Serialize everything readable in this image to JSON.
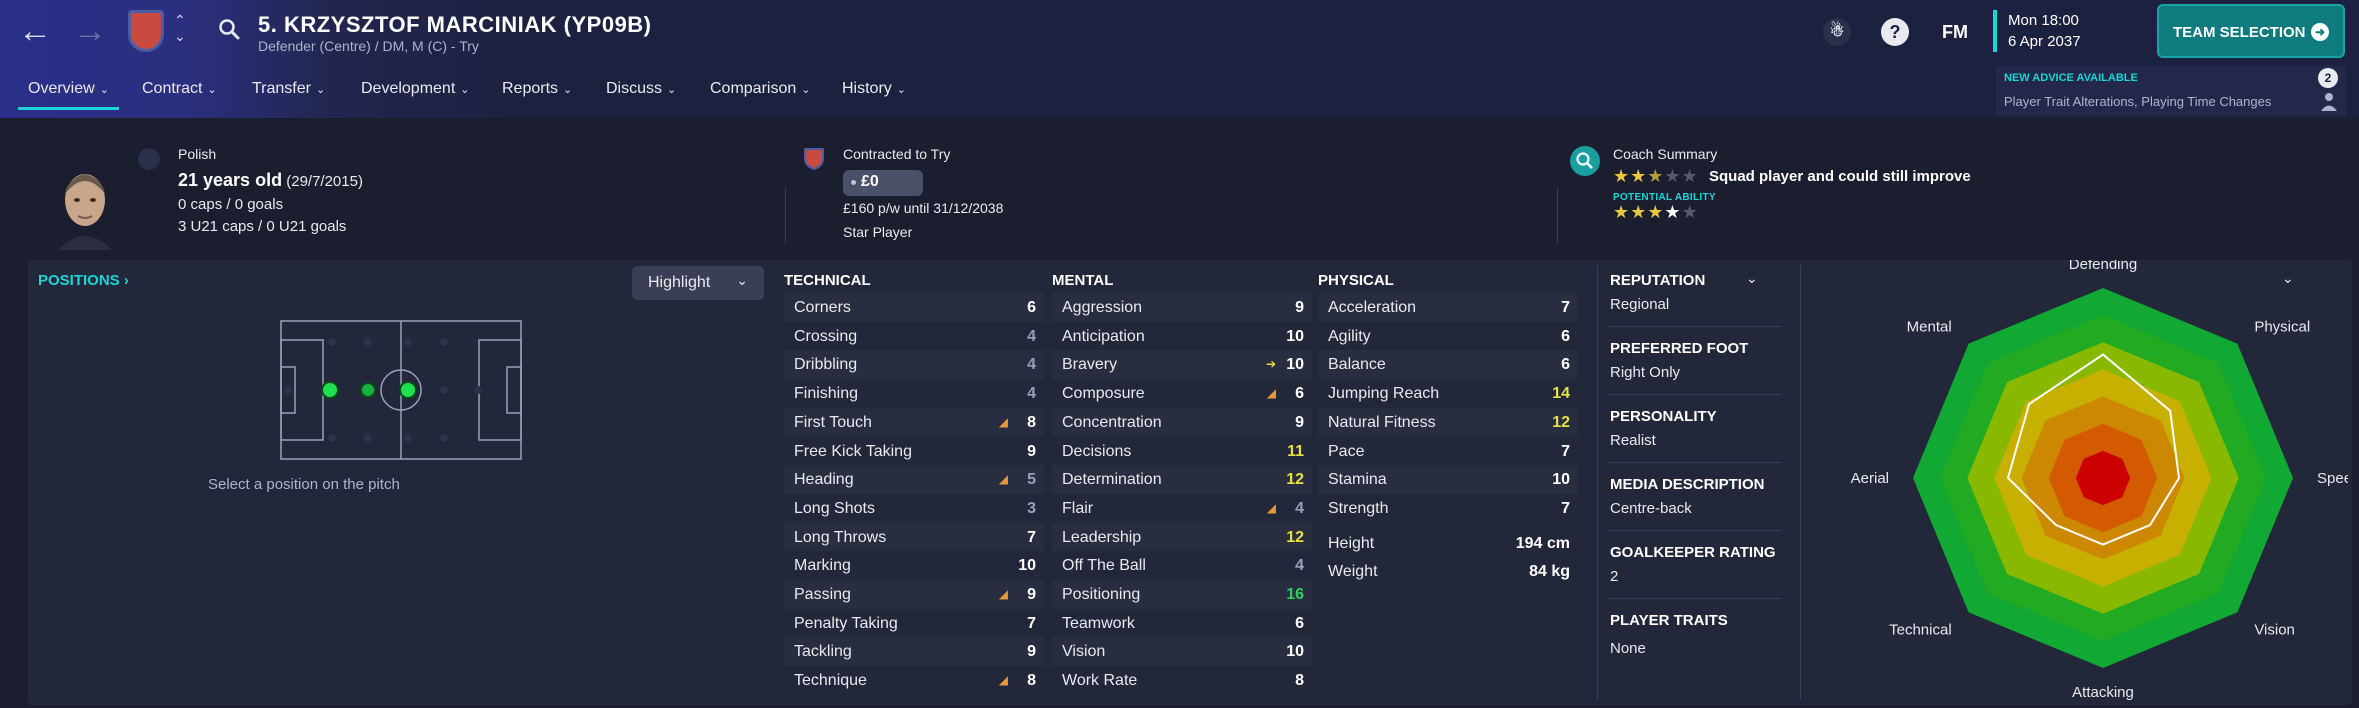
{
  "header": {
    "title": "5. KRZYSZTOF MARCINIAK (YP09B)",
    "subtitle": "Defender (Centre) / DM, M (C) - Try",
    "fm_logo": "FM",
    "time": "Mon 18:00",
    "date": "6 Apr 2037",
    "team_selection_label": "TEAM SELECTION",
    "help_icon": "?",
    "advice": {
      "title": "NEW ADVICE AVAILABLE",
      "text": "Player Trait Alterations, Playing Time Changes",
      "count": "2"
    },
    "tabs": [
      {
        "label": "Overview"
      },
      {
        "label": "Contract"
      },
      {
        "label": "Transfer"
      },
      {
        "label": "Development"
      },
      {
        "label": "Reports"
      },
      {
        "label": "Discuss"
      },
      {
        "label": "Comparison"
      },
      {
        "label": "History"
      }
    ]
  },
  "summary": {
    "nationality": "Polish",
    "age": "21 years old",
    "dob": "(29/7/2015)",
    "caps": "0 caps / 0 goals",
    "u21_caps": "3 U21 caps / 0 U21 goals",
    "contract_status": "Contracted to Try",
    "value": "£0",
    "wage": "£160 p/w until 31/12/2038",
    "status": "Star Player",
    "coach_title": "Coach Summary",
    "coach_comment": "Squad player and could still improve",
    "current_ability_stars": 2.5,
    "potential_label": "POTENTIAL ABILITY",
    "potential_ability_stars": 3.5
  },
  "positions": {
    "label": "POSITIONS",
    "highlight_label": "Highlight",
    "caption": "Select a position on the pitch"
  },
  "attributes": {
    "technical_label": "TECHNICAL",
    "mental_label": "MENTAL",
    "physical_label": "PHYSICAL",
    "technical": [
      {
        "name": "Corners",
        "value": "6",
        "tier": "mid"
      },
      {
        "name": "Crossing",
        "value": "4",
        "tier": "low"
      },
      {
        "name": "Dribbling",
        "value": "4",
        "tier": "low"
      },
      {
        "name": "Finishing",
        "value": "4",
        "tier": "low"
      },
      {
        "name": "First Touch",
        "value": "8",
        "tier": "mid",
        "trend": "up"
      },
      {
        "name": "Free Kick Taking",
        "value": "9",
        "tier": "mid"
      },
      {
        "name": "Heading",
        "value": "5",
        "tier": "low",
        "trend": "up"
      },
      {
        "name": "Long Shots",
        "value": "3",
        "tier": "low"
      },
      {
        "name": "Long Throws",
        "value": "7",
        "tier": "mid"
      },
      {
        "name": "Marking",
        "value": "10",
        "tier": "mid"
      },
      {
        "name": "Passing",
        "value": "9",
        "tier": "mid",
        "trend": "up"
      },
      {
        "name": "Penalty Taking",
        "value": "7",
        "tier": "mid"
      },
      {
        "name": "Tackling",
        "value": "9",
        "tier": "mid"
      },
      {
        "name": "Technique",
        "value": "8",
        "tier": "mid",
        "trend": "up"
      }
    ],
    "mental": [
      {
        "name": "Aggression",
        "value": "9",
        "tier": "mid"
      },
      {
        "name": "Anticipation",
        "value": "10",
        "tier": "mid"
      },
      {
        "name": "Bravery",
        "value": "10",
        "tier": "mid",
        "trend": "up2"
      },
      {
        "name": "Composure",
        "value": "6",
        "tier": "mid",
        "trend": "up"
      },
      {
        "name": "Concentration",
        "value": "9",
        "tier": "mid"
      },
      {
        "name": "Decisions",
        "value": "11",
        "tier": "hi"
      },
      {
        "name": "Determination",
        "value": "12",
        "tier": "hi"
      },
      {
        "name": "Flair",
        "value": "4",
        "tier": "low",
        "trend": "up"
      },
      {
        "name": "Leadership",
        "value": "12",
        "tier": "hi"
      },
      {
        "name": "Off The Ball",
        "value": "4",
        "tier": "low"
      },
      {
        "name": "Positioning",
        "value": "16",
        "tier": "top"
      },
      {
        "name": "Teamwork",
        "value": "6",
        "tier": "mid"
      },
      {
        "name": "Vision",
        "value": "10",
        "tier": "mid"
      },
      {
        "name": "Work Rate",
        "value": "8",
        "tier": "mid"
      }
    ],
    "physical": [
      {
        "name": "Acceleration",
        "value": "7",
        "tier": "mid"
      },
      {
        "name": "Agility",
        "value": "6",
        "tier": "mid"
      },
      {
        "name": "Balance",
        "value": "6",
        "tier": "mid"
      },
      {
        "name": "Jumping Reach",
        "value": "14",
        "tier": "hi"
      },
      {
        "name": "Natural Fitness",
        "value": "12",
        "tier": "hi"
      },
      {
        "name": "Pace",
        "value": "7",
        "tier": "mid"
      },
      {
        "name": "Stamina",
        "value": "10",
        "tier": "mid"
      },
      {
        "name": "Strength",
        "value": "7",
        "tier": "mid"
      }
    ],
    "height_label": "Height",
    "height": "194 cm",
    "weight_label": "Weight",
    "weight": "84 kg"
  },
  "profile": {
    "reputation_label": "REPUTATION",
    "reputation": "Regional",
    "foot_label": "PREFERRED FOOT",
    "foot": "Right Only",
    "personality_label": "PERSONALITY",
    "personality": "Realist",
    "media_label": "MEDIA DESCRIPTION",
    "media": "Centre-back",
    "gk_label": "GOALKEEPER RATING",
    "gk": "2",
    "traits_label": "PLAYER TRAITS",
    "traits": "None"
  },
  "chart_data": {
    "type": "radar",
    "axes": [
      "Defending",
      "Physical",
      "Speed",
      "Vision",
      "Attacking",
      "Technical",
      "Aerial",
      "Mental"
    ],
    "scale": [
      0,
      20
    ],
    "values": [
      13,
      10,
      8,
      7,
      7,
      7,
      10,
      11
    ],
    "band_colors": [
      "#cc0000",
      "#d45a00",
      "#cc8800",
      "#c8b000",
      "#88b800",
      "#22aa22",
      "#11a833"
    ]
  }
}
